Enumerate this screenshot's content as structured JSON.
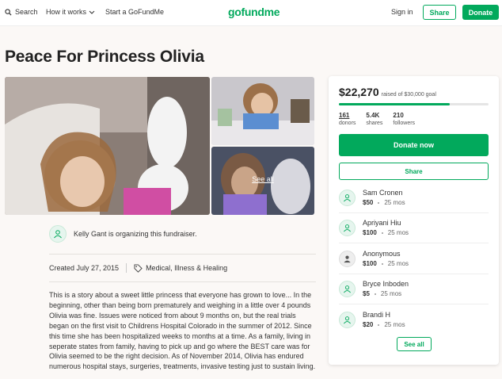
{
  "nav": {
    "search_label": "Search",
    "how_label": "How it works",
    "start_label": "Start a GoFundMe",
    "logo": "gofundme",
    "signin_label": "Sign in",
    "share_label": "Share",
    "donate_label": "Donate"
  },
  "campaign": {
    "title": "Peace For Princess Olivia",
    "photos_link": "See all",
    "organizer_text": "Kelly Gant is organizing this fundraiser.",
    "created": "Created July 27, 2015",
    "category": "Medical, Illness & Healing",
    "story": "This is a story about a sweet little princess that everyone has grown to love... In the beginning, other than being born prematurely and weighing in a little over 4 pounds Olivia was fine.  Issues were noticed from about 9 months on, but the real trials began on the first visit  to Childrens Hospital Colorado in the summer of 2012.  Since this time she has been hospitalized weeks to months at a time.  As a family, living in seperate states from family, having to pick up and go where the BEST care was for Olivia seemed to be the right decision.  As of November 2014, Olivia has endured numerous hospital stays, surgeries, treatments, invasive testing just to sustain living."
  },
  "sidebar": {
    "raised": "$22,270",
    "goal_text": "raised of $30,000 goal",
    "progress": 0.742,
    "stats": [
      {
        "value": "161",
        "label": "donors"
      },
      {
        "value": "5.4K",
        "label": "shares"
      },
      {
        "value": "210",
        "label": "followers"
      }
    ],
    "donate_label": "Donate now",
    "share_label": "Share",
    "donors": [
      {
        "name": "Sam Cronen",
        "amount": "$50",
        "time": "25 mos"
      },
      {
        "name": "Apriyani Hiu",
        "amount": "$100",
        "time": "25 mos"
      },
      {
        "name": "Anonymous",
        "amount": "$100",
        "time": "25 mos"
      },
      {
        "name": "Bryce Inboden",
        "amount": "$5",
        "time": "25 mos"
      },
      {
        "name": "Brandi H",
        "amount": "$20",
        "time": "25 mos"
      }
    ],
    "see_all_label": "See all"
  },
  "colors": {
    "brand": "#02a95c"
  },
  "icons": [
    "search-icon",
    "chevron-down-icon",
    "tag-icon",
    "person-icon",
    "heart-icon"
  ]
}
